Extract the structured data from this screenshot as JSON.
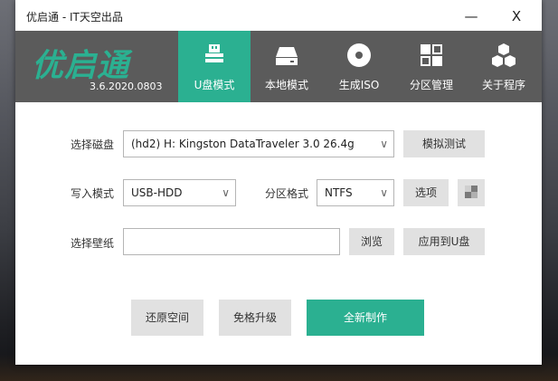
{
  "window": {
    "title": "优启通 - IT天空出品",
    "minimize_symbol": "—",
    "close_symbol": "X"
  },
  "header": {
    "logo_text": "优启通",
    "version": "3.6.2020.0803",
    "tabs": [
      {
        "label": "U盘模式",
        "icon": "usb-drive-icon",
        "active": true
      },
      {
        "label": "本地模式",
        "icon": "hard-disk-icon",
        "active": false
      },
      {
        "label": "生成ISO",
        "icon": "disc-icon",
        "active": false
      },
      {
        "label": "分区管理",
        "icon": "partition-grid-icon",
        "active": false
      },
      {
        "label": "关于程序",
        "icon": "cubes-icon",
        "active": false
      }
    ]
  },
  "form": {
    "disk_label": "选择磁盘",
    "disk_value": "(hd2) H: Kingston DataTraveler 3.0 26.4g",
    "simulate_button": "模拟测试",
    "write_mode_label": "写入模式",
    "write_mode_value": "USB-HDD",
    "partition_format_label": "分区格式",
    "partition_format_value": "NTFS",
    "options_button": "选项",
    "wallpaper_label": "选择壁纸",
    "wallpaper_value": "",
    "browse_button": "浏览",
    "apply_button": "应用到U盘"
  },
  "actions": {
    "restore_space": "还原空间",
    "upgrade_no_format": "免格升级",
    "make_new": "全新制作"
  },
  "colors": {
    "accent": "#2bb091",
    "header_bg": "#5b5b5b",
    "button_bg": "#e1e1e1"
  }
}
